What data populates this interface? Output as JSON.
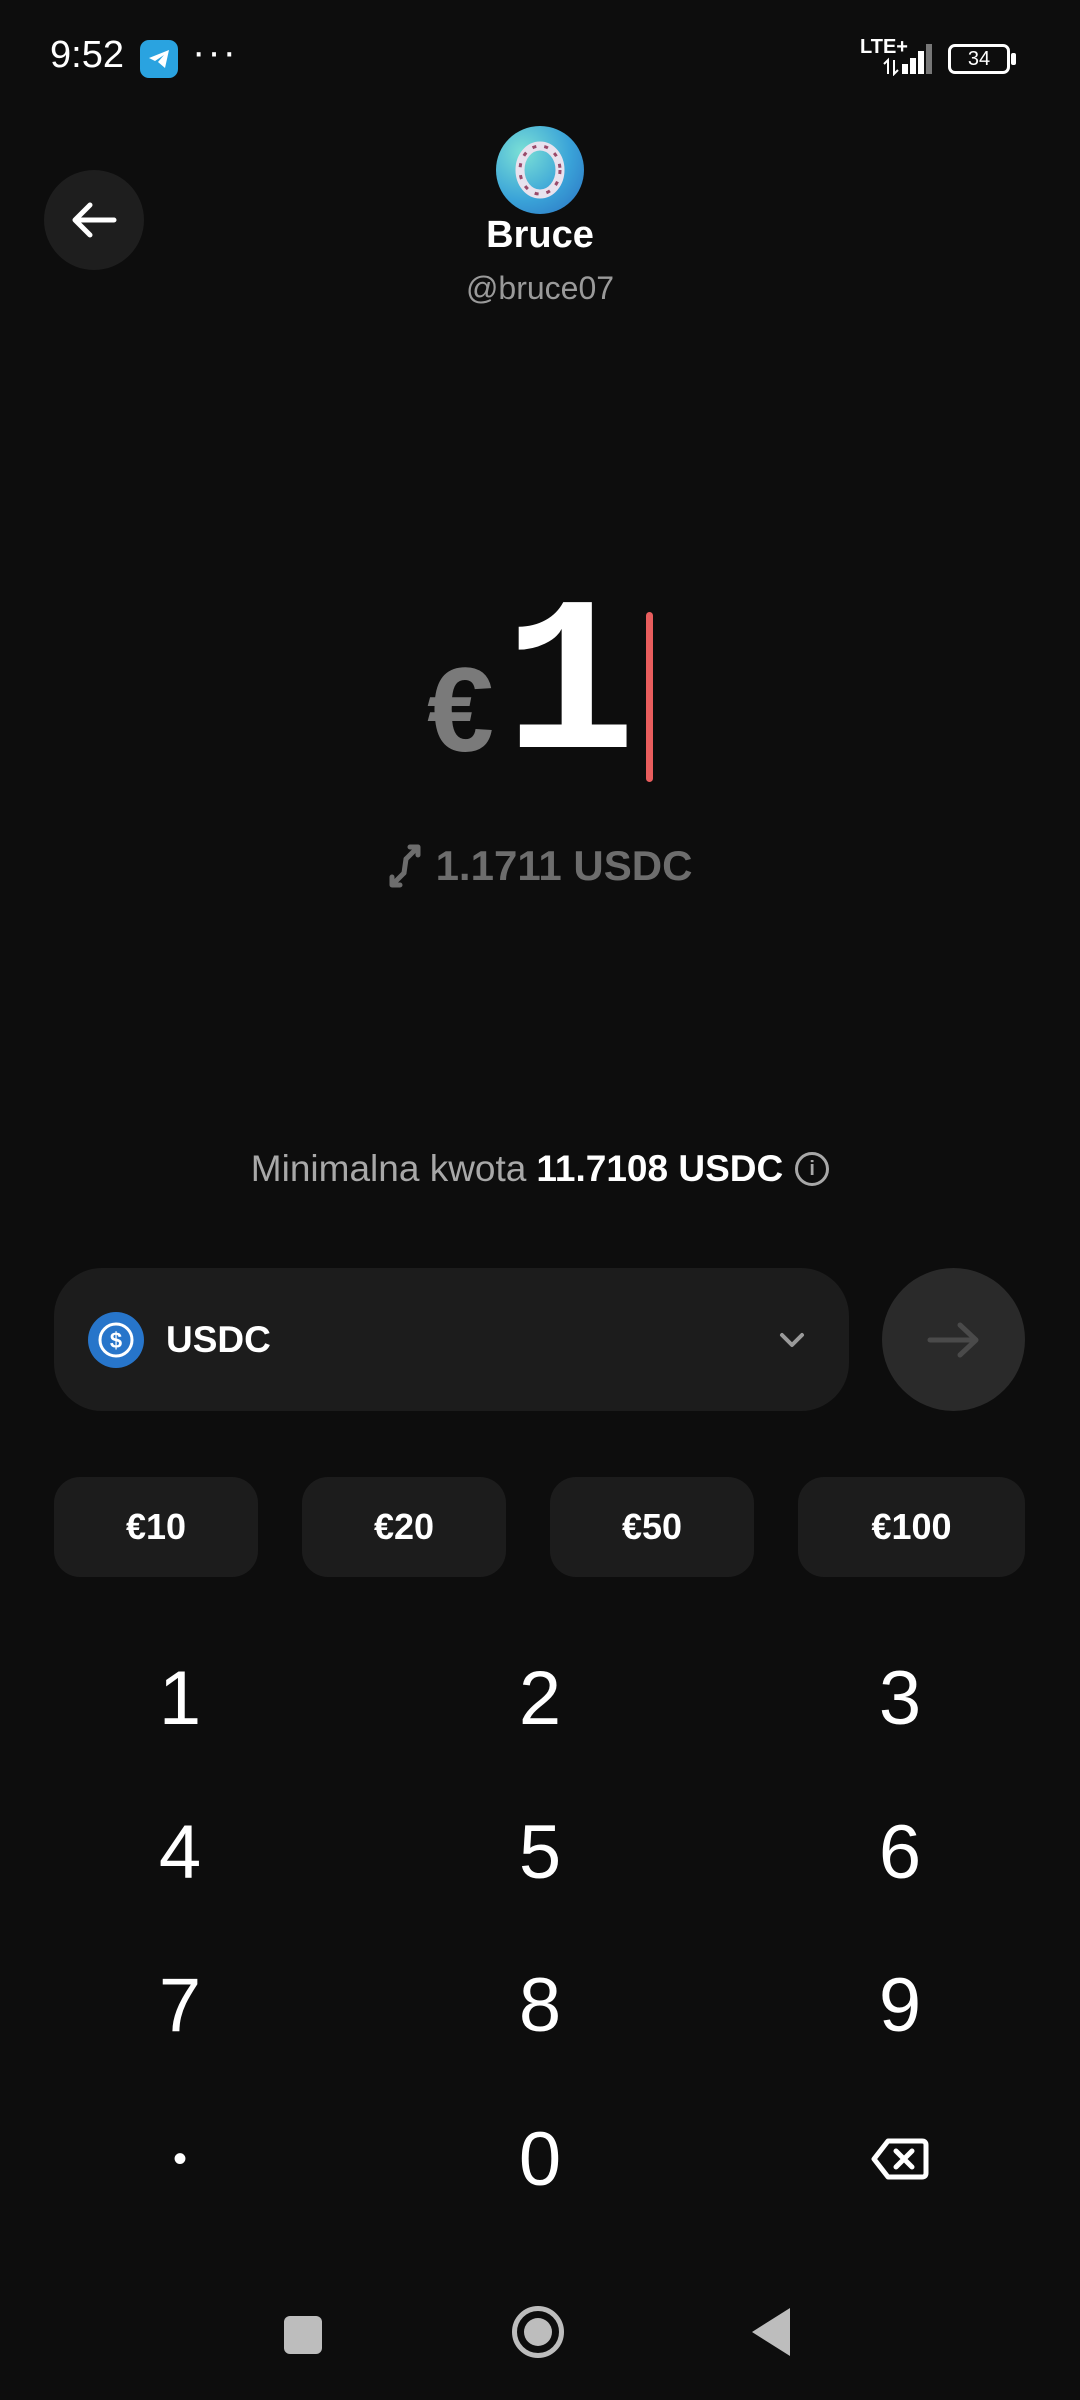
{
  "status_bar": {
    "time": "9:52",
    "more": "···",
    "network": "LTE+",
    "battery": "34"
  },
  "recipient": {
    "name": "Bruce",
    "handle": "@bruce07"
  },
  "amount": {
    "currency_symbol": "€",
    "value": "1",
    "converted": "1.1711 USDC"
  },
  "minimum": {
    "label": "Minimalna kwota",
    "value": "11.7108 USDC"
  },
  "token": {
    "label": "USDC",
    "icon": "usdc-icon"
  },
  "presets": [
    "€10",
    "€20",
    "€50",
    "€100"
  ],
  "keypad": [
    "1",
    "2",
    "3",
    "4",
    "5",
    "6",
    "7",
    "8",
    "9",
    "•",
    "0",
    "backspace"
  ],
  "colors": {
    "background": "#0d0d0d",
    "cursor": "#e85d5d",
    "usdc": "#2775ca"
  }
}
